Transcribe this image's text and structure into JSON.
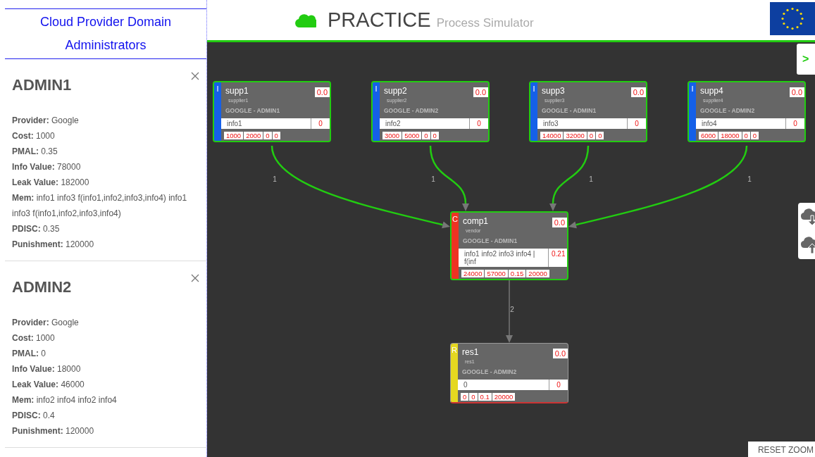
{
  "sidebar": {
    "title": "Cloud Provider Domain Administrators",
    "admins": [
      {
        "name": "ADMIN1",
        "fields": [
          "**Provider:** Google",
          "**Cost:** 1000",
          "**PMAL:** 0.35",
          "**Info Value:** 78000",
          "**Leak Value:** 182000",
          "**Mem:** info1 info3 f(info1,info2,info3,info4) info1 info3 f(info1,info2,info3,info4)",
          "**PDISC:** 0.35",
          "**Punishment:** 120000"
        ]
      },
      {
        "name": "ADMIN2",
        "fields": [
          "**Provider:** Google",
          "**Cost:** 1000",
          "**PMAL:** 0",
          "**Info Value:** 18000",
          "**Leak Value:** 46000",
          "**Mem:** info2 info4 info2 info4",
          "**PDISC:** 0.4",
          "**Punishment:** 120000"
        ]
      }
    ]
  },
  "header": {
    "title": "PRACTICE",
    "subtitle": "Process Simulator"
  },
  "side_tab": ">",
  "nodes": [
    {
      "type": "I",
      "color": "#1560e8",
      "name": "supp1",
      "subtitle": "supplier1",
      "owner": "GOOGLE - ADMIN1",
      "score": "0.0",
      "info": "info1",
      "info_value": "0",
      "values": [
        "1000",
        "2000",
        "0",
        "0"
      ],
      "selected": true
    },
    {
      "type": "I",
      "color": "#1560e8",
      "name": "supp2",
      "subtitle": "supplier2",
      "owner": "GOOGLE - ADMIN2",
      "score": "0.0",
      "info": "info2",
      "info_value": "0",
      "values": [
        "3000",
        "5000",
        "0",
        "0"
      ],
      "selected": true
    },
    {
      "type": "I",
      "color": "#1560e8",
      "name": "supp3",
      "subtitle": "supplier3",
      "owner": "GOOGLE - ADMIN1",
      "score": "0.0",
      "info": "info3",
      "info_value": "0",
      "values": [
        "14000",
        "32000",
        "0",
        "0"
      ],
      "selected": true
    },
    {
      "type": "I",
      "color": "#1560e8",
      "name": "supp4",
      "subtitle": "supplier4",
      "owner": "GOOGLE - ADMIN2",
      "score": "0.0",
      "info": "info4",
      "info_value": "0",
      "values": [
        "6000",
        "18000",
        "0",
        "0"
      ],
      "selected": true
    },
    {
      "type": "C",
      "color": "#ee3322",
      "name": "comp1",
      "subtitle": "vendor",
      "owner": "GOOGLE - ADMIN1",
      "score": "0.0",
      "info": "info1 info2 info3 info4 | f(inf",
      "info_value": "0.21",
      "values": [
        "24000",
        "57000",
        "0.15",
        "20000"
      ],
      "selected": true
    },
    {
      "type": "R",
      "color": "#e5d820",
      "name": "res1",
      "subtitle": "res1",
      "owner": "GOOGLE - ADMIN2",
      "score": "0.0",
      "info": "0",
      "info_value": "0",
      "values": [
        "0",
        "0",
        "0.1",
        "20000"
      ],
      "selected": false
    }
  ],
  "edges": [
    {
      "label": "1",
      "highlighted": true
    },
    {
      "label": "1",
      "highlighted": true
    },
    {
      "label": "1",
      "highlighted": true
    },
    {
      "label": "1",
      "highlighted": true
    },
    {
      "label": "2",
      "highlighted": false
    }
  ],
  "reset_zoom": "RESET ZOOM"
}
